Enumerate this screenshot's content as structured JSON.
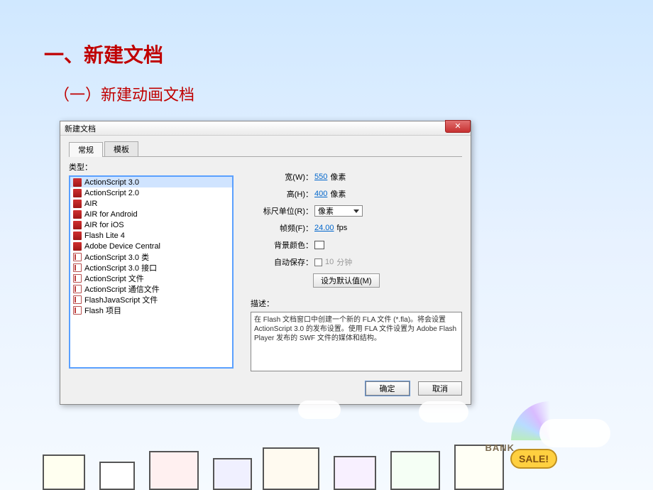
{
  "page": {
    "title": "一、新建文档",
    "subtitle": "（一）新建动画文档"
  },
  "dialog": {
    "title": "新建文档",
    "close": "✕",
    "tabs": {
      "general": "常规",
      "template": "模板"
    },
    "type_label": "类型：",
    "types": [
      {
        "label": "ActionScript 3.0",
        "icon": "fla",
        "selected": true
      },
      {
        "label": "ActionScript 2.0",
        "icon": "fla"
      },
      {
        "label": "AIR",
        "icon": "fla"
      },
      {
        "label": "AIR for Android",
        "icon": "fla"
      },
      {
        "label": "AIR for iOS",
        "icon": "fla"
      },
      {
        "label": "Flash Lite 4",
        "icon": "fla"
      },
      {
        "label": "Adobe Device Central",
        "icon": "fla"
      },
      {
        "label": "ActionScript 3.0 类",
        "icon": "as"
      },
      {
        "label": "ActionScript 3.0 接口",
        "icon": "as"
      },
      {
        "label": "ActionScript 文件",
        "icon": "as"
      },
      {
        "label": "ActionScript 通信文件",
        "icon": "as"
      },
      {
        "label": "FlashJavaScript 文件",
        "icon": "as"
      },
      {
        "label": "Flash 项目",
        "icon": "as"
      }
    ],
    "form": {
      "width_label": "宽(W)：",
      "width_value": "550",
      "px": "像素",
      "height_label": "高(H)：",
      "height_value": "400",
      "ruler_label": "标尺单位(R)：",
      "ruler_value": "像素",
      "fps_label": "帧频(F)：",
      "fps_value": "24.00",
      "fps_unit": "fps",
      "bg_label": "背景颜色：",
      "autosave_label": "自动保存：",
      "autosave_value": "10",
      "autosave_unit": "分钟",
      "default_btn": "设为默认值(M)"
    },
    "desc_label": "描述：",
    "desc_text": "在 Flash 文档窗口中创建一个新的 FLA 文件 (*.fla)。将会设置 ActionScript 3.0 的发布设置。使用 FLA 文件设置为 Adobe Flash Player 发布的 SWF 文件的媒体和结构。",
    "buttons": {
      "ok": "确定",
      "cancel": "取消"
    }
  },
  "decor": {
    "sale": "SALE!",
    "bank": "BANK"
  }
}
